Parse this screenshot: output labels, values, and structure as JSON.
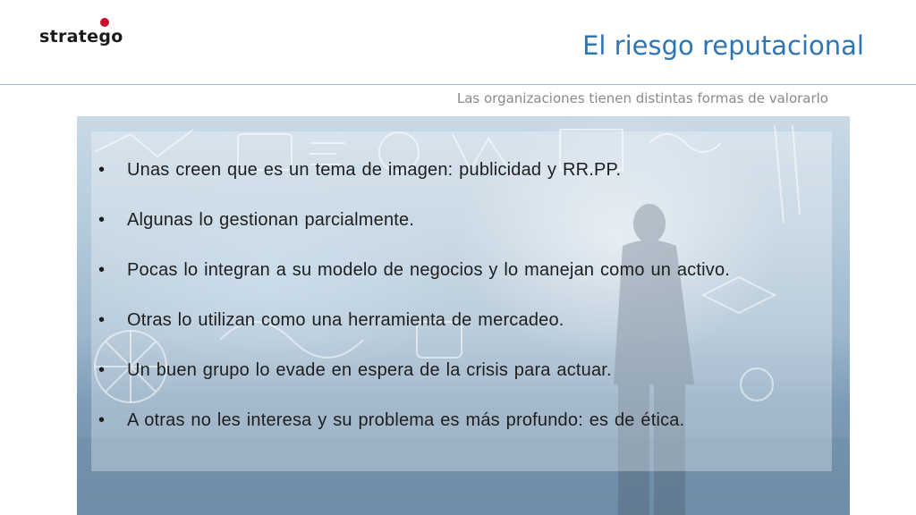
{
  "logo": {
    "text": "stratego"
  },
  "header": {
    "title": "El riesgo reputacional",
    "subtitle": "Las organizaciones tienen distintas formas de valorarlo"
  },
  "bullet_glyph": "•",
  "bullets": [
    "Unas creen que es un tema de imagen: publicidad y RR.PP.",
    "Algunas lo gestionan parcialmente.",
    "Pocas lo integran a su modelo de negocios y lo manejan como un activo.",
    "Otras lo utilizan como una herramienta de mercadeo.",
    "Un buen grupo lo evade en espera de la crisis para actuar.",
    "A otras no les interesa y su problema es más profundo: es de ética."
  ],
  "colors": {
    "title": "#2e75b6",
    "rule": "#9dc3e6",
    "subtitle": "#8a8a8a",
    "logo_accent": "#c8102e",
    "body_text": "#1e1e1e"
  }
}
